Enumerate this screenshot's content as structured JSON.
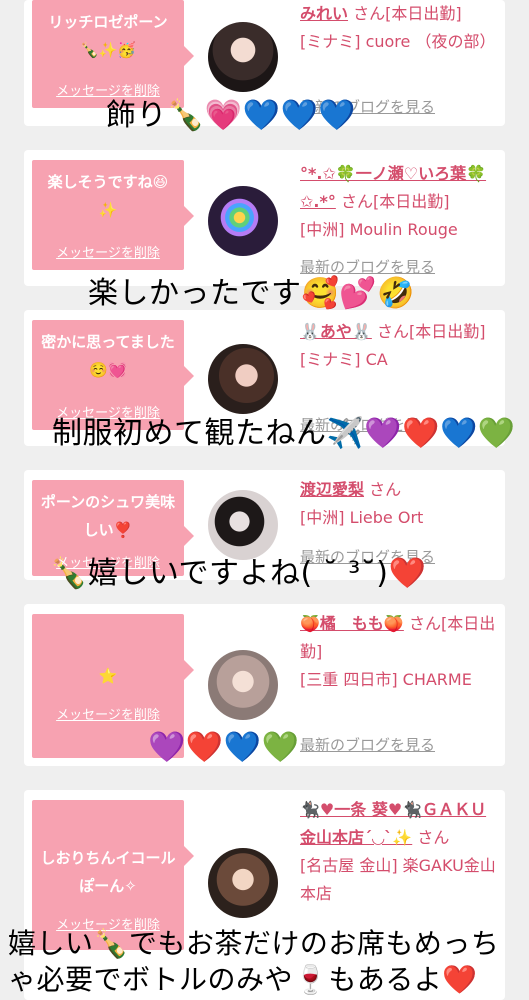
{
  "cards": [
    {
      "message": "リッチロゼポーン🍾✨🥳",
      "delete_label": "メッセージを削除",
      "name": "みれい",
      "suffix": "さん[本日出勤]",
      "shop": "[ミナミ] cuore （夜の部）",
      "blog": "最新のブログを見る"
    },
    {
      "message": "楽しそうですね😆✨",
      "delete_label": "メッセージを削除",
      "name": "°*.✩🍀一ノ瀬♡いろ葉🍀✩.*°",
      "suffix": "さん[本日出勤]",
      "shop": "[中洲] Moulin Rouge",
      "blog": "最新のブログを見る"
    },
    {
      "message": "密かに思ってました☺️💓",
      "delete_label": "メッセージを削除",
      "name": "🐰あや🐰",
      "suffix": "さん[本日出勤]",
      "shop": "[ミナミ] CA",
      "blog": "最新のブログを見る"
    },
    {
      "message": "ポーンのシュワ美味しい❣️",
      "delete_label": "メッセージを削除",
      "name": "渡辺愛梨",
      "suffix": "さん",
      "shop": "[中洲] Liebe Ort",
      "blog": "最新のブログを見る"
    },
    {
      "message": "⭐",
      "delete_label": "メッセージを削除",
      "name": "🍑橘　もも🍑",
      "suffix": "さん[本日出勤]",
      "shop": "[三重 四日市] CHARME",
      "blog": "最新のブログを見る"
    },
    {
      "message": "しおりちんイコールぽーん✧",
      "delete_label": "メッセージを削除",
      "name": "🐈‍⬛♥一条 葵♥🐈‍⬛ＧＡＫＵ金山本店´◡`✨",
      "suffix": "さん",
      "shop": "[名古屋 金山] 楽GAKU金山本店",
      "blog": "最新のブログを見る"
    }
  ],
  "overlays": {
    "o1": "飾り🍾💗💙💙💙",
    "o2": "楽しかったです🥰💕🤣",
    "o3": "制服初めて観たねん✈️💜❤️💙💚",
    "o4": "🍾嬉しいですよね( ˘ ³˘)❤️",
    "o5": "💜❤️💙💚",
    "o6a": "嬉しい🍾でもお茶だけのお席もめっち",
    "o6b": "ゃ必要でボトルのみや🍷もあるよ❤️"
  }
}
